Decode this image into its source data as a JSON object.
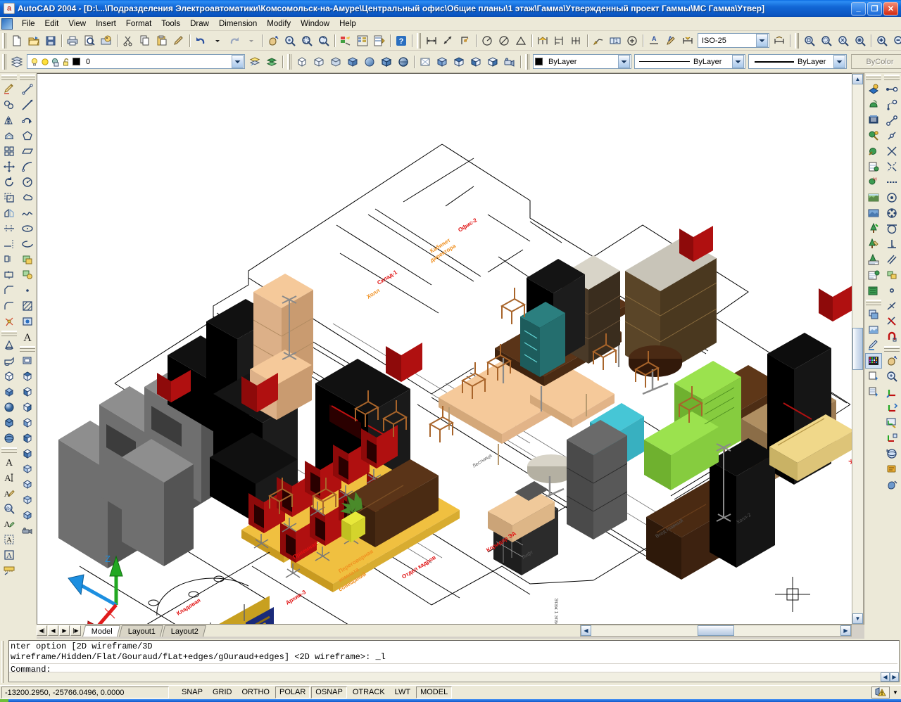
{
  "window": {
    "title": "AutoCAD 2004 - [D:\\...\\Подразделения Электроавтоматики\\Комсомольск-на-Амуре\\Центральный офис\\Общие планы\\1 этаж\\Гамма\\Утвержденный проект Гаммы\\МС Гамма\\Утвер]",
    "app_icon": "a",
    "minimize_label": "_",
    "maximize_label": "❐",
    "close_label": "✕"
  },
  "menu": {
    "items": [
      {
        "label": "File"
      },
      {
        "label": "Edit"
      },
      {
        "label": "View"
      },
      {
        "label": "Insert"
      },
      {
        "label": "Format"
      },
      {
        "label": "Tools"
      },
      {
        "label": "Draw"
      },
      {
        "label": "Dimension"
      },
      {
        "label": "Modify"
      },
      {
        "label": "Window"
      },
      {
        "label": "Help"
      }
    ]
  },
  "toolbar_standard": {
    "buttons": [
      {
        "name": "new-icon",
        "tip": "QNew"
      },
      {
        "name": "open-icon",
        "tip": "Open"
      },
      {
        "name": "save-icon",
        "tip": "Save"
      },
      {
        "name": "plot-icon",
        "tip": "Plot"
      },
      {
        "name": "plot-preview-icon",
        "tip": "Plot Preview"
      },
      {
        "name": "publish-icon",
        "tip": "Publish"
      },
      {
        "name": "cut-icon",
        "tip": "Cut"
      },
      {
        "name": "copy-icon",
        "tip": "Copy"
      },
      {
        "name": "paste-icon",
        "tip": "Paste"
      },
      {
        "name": "match-properties-icon",
        "tip": "Match Properties"
      },
      {
        "name": "undo-icon",
        "tip": "Undo"
      },
      {
        "name": "undo-dropdown-icon",
        "tip": "Undo list"
      },
      {
        "name": "redo-icon",
        "tip": "Redo"
      },
      {
        "name": "redo-dropdown-icon",
        "tip": "Redo list"
      },
      {
        "name": "pan-realtime-icon",
        "tip": "Pan Realtime"
      },
      {
        "name": "zoom-realtime-icon",
        "tip": "Zoom Realtime"
      },
      {
        "name": "zoom-window-icon",
        "tip": "Zoom Window"
      },
      {
        "name": "zoom-previous-icon",
        "tip": "Zoom Previous"
      },
      {
        "name": "properties-icon",
        "tip": "Properties"
      },
      {
        "name": "designcenter-icon",
        "tip": "DesignCenter"
      },
      {
        "name": "tool-palettes-icon",
        "tip": "Tool Palettes"
      },
      {
        "name": "help-icon",
        "tip": "Help"
      }
    ]
  },
  "toolbar_dimension": {
    "buttons": [
      {
        "name": "linear-dimension-icon",
        "tip": "Linear Dimension"
      },
      {
        "name": "aligned-dimension-icon",
        "tip": "Aligned Dimension"
      },
      {
        "name": "ordinate-dimension-icon",
        "tip": "Ordinate Dimension"
      },
      {
        "name": "radius-dimension-icon",
        "tip": "Radius Dimension"
      },
      {
        "name": "diameter-dimension-icon",
        "tip": "Diameter Dimension"
      },
      {
        "name": "angular-dimension-icon",
        "tip": "Angular Dimension"
      },
      {
        "name": "quick-dimension-icon",
        "tip": "Quick Dimension"
      },
      {
        "name": "baseline-dimension-icon",
        "tip": "Baseline Dimension"
      },
      {
        "name": "continue-dimension-icon",
        "tip": "Continue Dimension"
      },
      {
        "name": "quick-leader-icon",
        "tip": "Quick Leader"
      },
      {
        "name": "tolerance-icon",
        "tip": "Tolerance"
      },
      {
        "name": "center-mark-icon",
        "tip": "Center Mark"
      },
      {
        "name": "dimension-edit-icon",
        "tip": "Dimension Edit"
      },
      {
        "name": "dimension-text-edit-icon",
        "tip": "Dimension Text Edit"
      },
      {
        "name": "dimension-update-icon",
        "tip": "Dimension Update"
      }
    ],
    "style_value": "ISO-25",
    "style_dropdown": "dimension-style-dropdown"
  },
  "toolbar_zoom": {
    "buttons": [
      {
        "name": "zoom-window-icon",
        "tip": "Zoom Window"
      },
      {
        "name": "zoom-dynamic-icon",
        "tip": "Zoom Dynamic"
      },
      {
        "name": "zoom-scale-icon",
        "tip": "Zoom Scale"
      },
      {
        "name": "zoom-center-icon",
        "tip": "Zoom Center"
      },
      {
        "name": "zoom-in-icon",
        "tip": "Zoom In"
      },
      {
        "name": "zoom-out-icon",
        "tip": "Zoom Out"
      },
      {
        "name": "zoom-all-icon",
        "tip": "Zoom All"
      },
      {
        "name": "zoom-extents-icon",
        "tip": "Zoom Extents"
      }
    ]
  },
  "toolbar_layers": {
    "layer_manager_icon": "layer-properties-manager-icon",
    "layer_value": "0",
    "layer_state_icons": [
      {
        "name": "lightbulb-on-icon"
      },
      {
        "name": "sun-freeze-icon"
      },
      {
        "name": "freeze-viewport-icon"
      },
      {
        "name": "unlocked-padlock-icon"
      }
    ],
    "layer_color_swatch": "#000000",
    "make_current_icon": "make-object-layer-current-icon",
    "layer_previous_icon": "layer-previous-icon"
  },
  "toolbar_properties": {
    "color_value": "ByLayer",
    "color_swatch": "#000000",
    "linetype_value": "ByLayer",
    "lineweight_value": "ByLayer",
    "plotstyle_value": "ByColor",
    "plotstyle_disabled": true
  },
  "toolbar_shade": {
    "buttons": [
      {
        "name": "2d-wireframe-icon",
        "tip": "2D Wireframe"
      },
      {
        "name": "3d-wireframe-icon",
        "tip": "3D Wireframe"
      },
      {
        "name": "hidden-icon",
        "tip": "Hidden"
      },
      {
        "name": "flat-shaded-icon",
        "tip": "Flat Shaded"
      },
      {
        "name": "gouraud-shaded-icon",
        "tip": "Gouraud Shaded"
      },
      {
        "name": "flat-shaded-edges-on-icon",
        "tip": "Flat Shaded, Edges On"
      },
      {
        "name": "gouraud-shaded-edges-on-icon",
        "tip": "Gouraud Shaded, Edges On"
      }
    ]
  },
  "toolbar_view": {
    "buttons": [
      {
        "name": "named-views-icon",
        "tip": "Named Views"
      },
      {
        "name": "top-view-icon",
        "tip": "Top View"
      },
      {
        "name": "bottom-view-icon",
        "tip": "Bottom View"
      },
      {
        "name": "left-view-icon",
        "tip": "Left View"
      },
      {
        "name": "right-view-icon",
        "tip": "Right View"
      },
      {
        "name": "front-view-icon",
        "tip": "Front View"
      },
      {
        "name": "back-view-icon",
        "tip": "Back View"
      },
      {
        "name": "sw-isometric-icon",
        "tip": "SW Isometric View"
      },
      {
        "name": "se-isometric-icon",
        "tip": "SE Isometric View"
      },
      {
        "name": "ne-isometric-icon",
        "tip": "NE Isometric View"
      },
      {
        "name": "nw-isometric-icon",
        "tip": "NW Isometric View"
      },
      {
        "name": "camera-icon",
        "tip": "Camera"
      }
    ]
  },
  "toolbar_modify_left": {
    "buttons": [
      {
        "name": "erase-icon",
        "tip": "Erase"
      },
      {
        "name": "copy-object-icon",
        "tip": "Copy Object"
      },
      {
        "name": "mirror-icon",
        "tip": "Mirror"
      },
      {
        "name": "offset-icon",
        "tip": "Offset"
      },
      {
        "name": "array-icon",
        "tip": "Array"
      },
      {
        "name": "move-icon",
        "tip": "Move"
      },
      {
        "name": "rotate-icon",
        "tip": "Rotate"
      },
      {
        "name": "scale-icon",
        "tip": "Scale"
      },
      {
        "name": "stretch-icon",
        "tip": "Stretch"
      },
      {
        "name": "trim-icon",
        "tip": "Trim"
      },
      {
        "name": "extend-icon",
        "tip": "Extend"
      },
      {
        "name": "break-at-point-icon",
        "tip": "Break at Point"
      },
      {
        "name": "break-icon",
        "tip": "Break"
      },
      {
        "name": "chamfer-icon",
        "tip": "Chamfer"
      },
      {
        "name": "fillet-icon",
        "tip": "Fillet"
      },
      {
        "name": "explode-icon",
        "tip": "Explode"
      }
    ]
  },
  "toolbar_draw_left": {
    "buttons": [
      {
        "name": "line-icon",
        "tip": "Line"
      },
      {
        "name": "construction-line-icon",
        "tip": "Construction Line"
      },
      {
        "name": "polyline-icon",
        "tip": "Polyline"
      },
      {
        "name": "polygon-icon",
        "tip": "Polygon"
      },
      {
        "name": "rectangle-icon",
        "tip": "Rectangle"
      },
      {
        "name": "arc-icon",
        "tip": "Arc"
      },
      {
        "name": "circle-icon",
        "tip": "Circle"
      },
      {
        "name": "revision-cloud-icon",
        "tip": "Revision Cloud"
      },
      {
        "name": "spline-icon",
        "tip": "Spline"
      },
      {
        "name": "ellipse-icon",
        "tip": "Ellipse"
      },
      {
        "name": "ellipse-arc-icon",
        "tip": "Ellipse Arc"
      },
      {
        "name": "insert-block-icon",
        "tip": "Insert Block"
      },
      {
        "name": "make-block-icon",
        "tip": "Make Block"
      },
      {
        "name": "point-icon",
        "tip": "Point"
      },
      {
        "name": "hatch-icon",
        "tip": "Hatch"
      },
      {
        "name": "region-icon",
        "tip": "Region"
      },
      {
        "name": "multiline-text-icon",
        "tip": "Multiline Text"
      }
    ]
  },
  "toolbar_solids_left": {
    "buttons": [
      {
        "name": "cone-solid-icon",
        "tip": "Cone"
      },
      {
        "name": "wedge-solid-icon",
        "tip": "Wedge"
      },
      {
        "name": "box-solid-icon",
        "tip": "Box"
      },
      {
        "name": "extrude-icon",
        "tip": "Extrude"
      },
      {
        "name": "sphere-solid-icon",
        "tip": "Sphere"
      },
      {
        "name": "cylinder-solid-icon",
        "tip": "Cylinder"
      },
      {
        "name": "torus-solid-icon",
        "tip": "Torus"
      }
    ]
  },
  "toolbar_text_left": {
    "buttons": [
      {
        "name": "multiline-text-icon",
        "tip": "Multiline Text"
      },
      {
        "name": "single-line-text-icon",
        "tip": "Single Line Text"
      },
      {
        "name": "edit-text-icon",
        "tip": "Edit Text"
      },
      {
        "name": "spell-check-icon",
        "tip": "Spell Check"
      },
      {
        "name": "find-replace-icon",
        "tip": "Find and Replace"
      },
      {
        "name": "text-style-icon",
        "tip": "Text Style"
      },
      {
        "name": "scale-text-icon",
        "tip": "Scale Text"
      },
      {
        "name": "convert-distance-icon",
        "tip": "Convert Distance"
      }
    ]
  },
  "toolbar_render_right": {
    "buttons": [
      {
        "name": "render-icon",
        "tip": "Render"
      },
      {
        "name": "scene-icon",
        "tip": "Scene"
      },
      {
        "name": "lights-icon",
        "tip": "Lights"
      },
      {
        "name": "materials-icon",
        "tip": "Materials"
      },
      {
        "name": "materials-library-icon",
        "tip": "Materials Library"
      },
      {
        "name": "mapping-icon",
        "tip": "Mapping"
      },
      {
        "name": "background-icon",
        "tip": "Background"
      },
      {
        "name": "fog-icon",
        "tip": "Fog"
      },
      {
        "name": "landscape-new-icon",
        "tip": "Landscape New"
      },
      {
        "name": "landscape-edit-icon",
        "tip": "Landscape Edit"
      },
      {
        "name": "landscape-library-icon",
        "tip": "Landscape Library"
      },
      {
        "name": "render-preferences-icon",
        "tip": "Render Preferences"
      },
      {
        "name": "statistics-icon",
        "tip": "Statistics"
      },
      {
        "name": "hide-icon",
        "tip": "Hide"
      },
      {
        "name": "shade-icon",
        "tip": "Shade"
      },
      {
        "name": "render-output-icon",
        "tip": "Render Output"
      },
      {
        "name": "display-image-icon",
        "tip": "Display Image"
      },
      {
        "name": "save-image-icon",
        "tip": "Save Image"
      }
    ]
  },
  "toolbar_osnap_right": {
    "buttons": [
      {
        "name": "temporary-track-point-icon",
        "tip": "Temporary Track Point"
      },
      {
        "name": "snap-from-icon",
        "tip": "Snap From"
      },
      {
        "name": "snap-endpoint-icon",
        "tip": "Snap to Endpoint"
      },
      {
        "name": "snap-midpoint-icon",
        "tip": "Snap to Midpoint"
      },
      {
        "name": "snap-intersection-icon",
        "tip": "Snap to Intersection"
      },
      {
        "name": "snap-apparent-intersect-icon",
        "tip": "Snap to Apparent Intersect"
      },
      {
        "name": "snap-extension-icon",
        "tip": "Snap to Extension"
      },
      {
        "name": "snap-center-icon",
        "tip": "Snap to Center"
      },
      {
        "name": "snap-quadrant-icon",
        "tip": "Snap to Quadrant"
      },
      {
        "name": "snap-tangent-icon",
        "tip": "Snap to Tangent"
      },
      {
        "name": "snap-perpendicular-icon",
        "tip": "Snap to Perpendicular"
      },
      {
        "name": "snap-parallel-icon",
        "tip": "Snap to Parallel"
      },
      {
        "name": "snap-insert-icon",
        "tip": "Snap to Insert"
      },
      {
        "name": "snap-node-icon",
        "tip": "Snap to Node"
      },
      {
        "name": "snap-nearest-icon",
        "tip": "Snap to Nearest"
      },
      {
        "name": "snap-none-icon",
        "tip": "Snap to None"
      },
      {
        "name": "osnap-settings-icon",
        "tip": "Object Snap Settings"
      }
    ]
  },
  "toolbar_ucs_right": {
    "buttons": [
      {
        "name": "pan-icon",
        "tip": "Pan"
      },
      {
        "name": "zoom-icon",
        "tip": "Zoom"
      },
      {
        "name": "ucs-icon",
        "tip": "UCS"
      },
      {
        "name": "ucs-previous-icon",
        "tip": "UCS Previous"
      },
      {
        "name": "display-ucs-dialog-icon",
        "tip": "Display UCS Dialog"
      },
      {
        "name": "ucs-icon-properties-icon",
        "tip": "UCS Icon Properties"
      },
      {
        "name": "3d-orbit-icon",
        "tip": "3D Orbit"
      },
      {
        "name": "3d-pan-icon",
        "tip": "3D Pan"
      },
      {
        "name": "3d-swivel-icon",
        "tip": "3D Swivel"
      }
    ]
  },
  "drawing": {
    "title": "Office floor plan - isometric 3D shaded view",
    "ucs_icon": {
      "x_axis_label": "X",
      "y_axis_label": "Y",
      "z_axis_label": "Z",
      "x_color": "#e01b1b",
      "y_color": "#1d8fe0",
      "z_color": "#22a822"
    },
    "background_color": "#ffffff",
    "annotation_colors": {
      "room_label_orange": "#f09020",
      "room_label_red": "#e01010",
      "wall_line": "#000000",
      "grid_line": "#707070"
    }
  },
  "layout_tabs": {
    "nav_first": "◀|",
    "nav_prev": "◀",
    "nav_next": "▶",
    "nav_last": "|▶",
    "tabs": [
      {
        "label": "Model",
        "active": true
      },
      {
        "label": "Layout1",
        "active": false
      },
      {
        "label": "Layout2",
        "active": false
      }
    ]
  },
  "command_window": {
    "lines": [
      "nter option [2D wireframe/3D",
      "wireframe/Hidden/Flat/Gouraud/fLat+edges/gOuraud+edges] <2D wireframe>: _l"
    ],
    "prompt": "Command:"
  },
  "status_bar": {
    "coordinates": "-13200.2950, -25766.0496, 0.0000",
    "toggles": [
      {
        "label": "SNAP",
        "on": false
      },
      {
        "label": "GRID",
        "on": false
      },
      {
        "label": "ORTHO",
        "on": false
      },
      {
        "label": "POLAR",
        "on": true
      },
      {
        "label": "OSNAP",
        "on": true
      },
      {
        "label": "OTRACK",
        "on": false
      },
      {
        "label": "LWT",
        "on": false
      },
      {
        "label": "MODEL",
        "on": true
      }
    ],
    "comm_center_icon": "communication-center-warning-icon",
    "comm_arrow": "▼"
  }
}
